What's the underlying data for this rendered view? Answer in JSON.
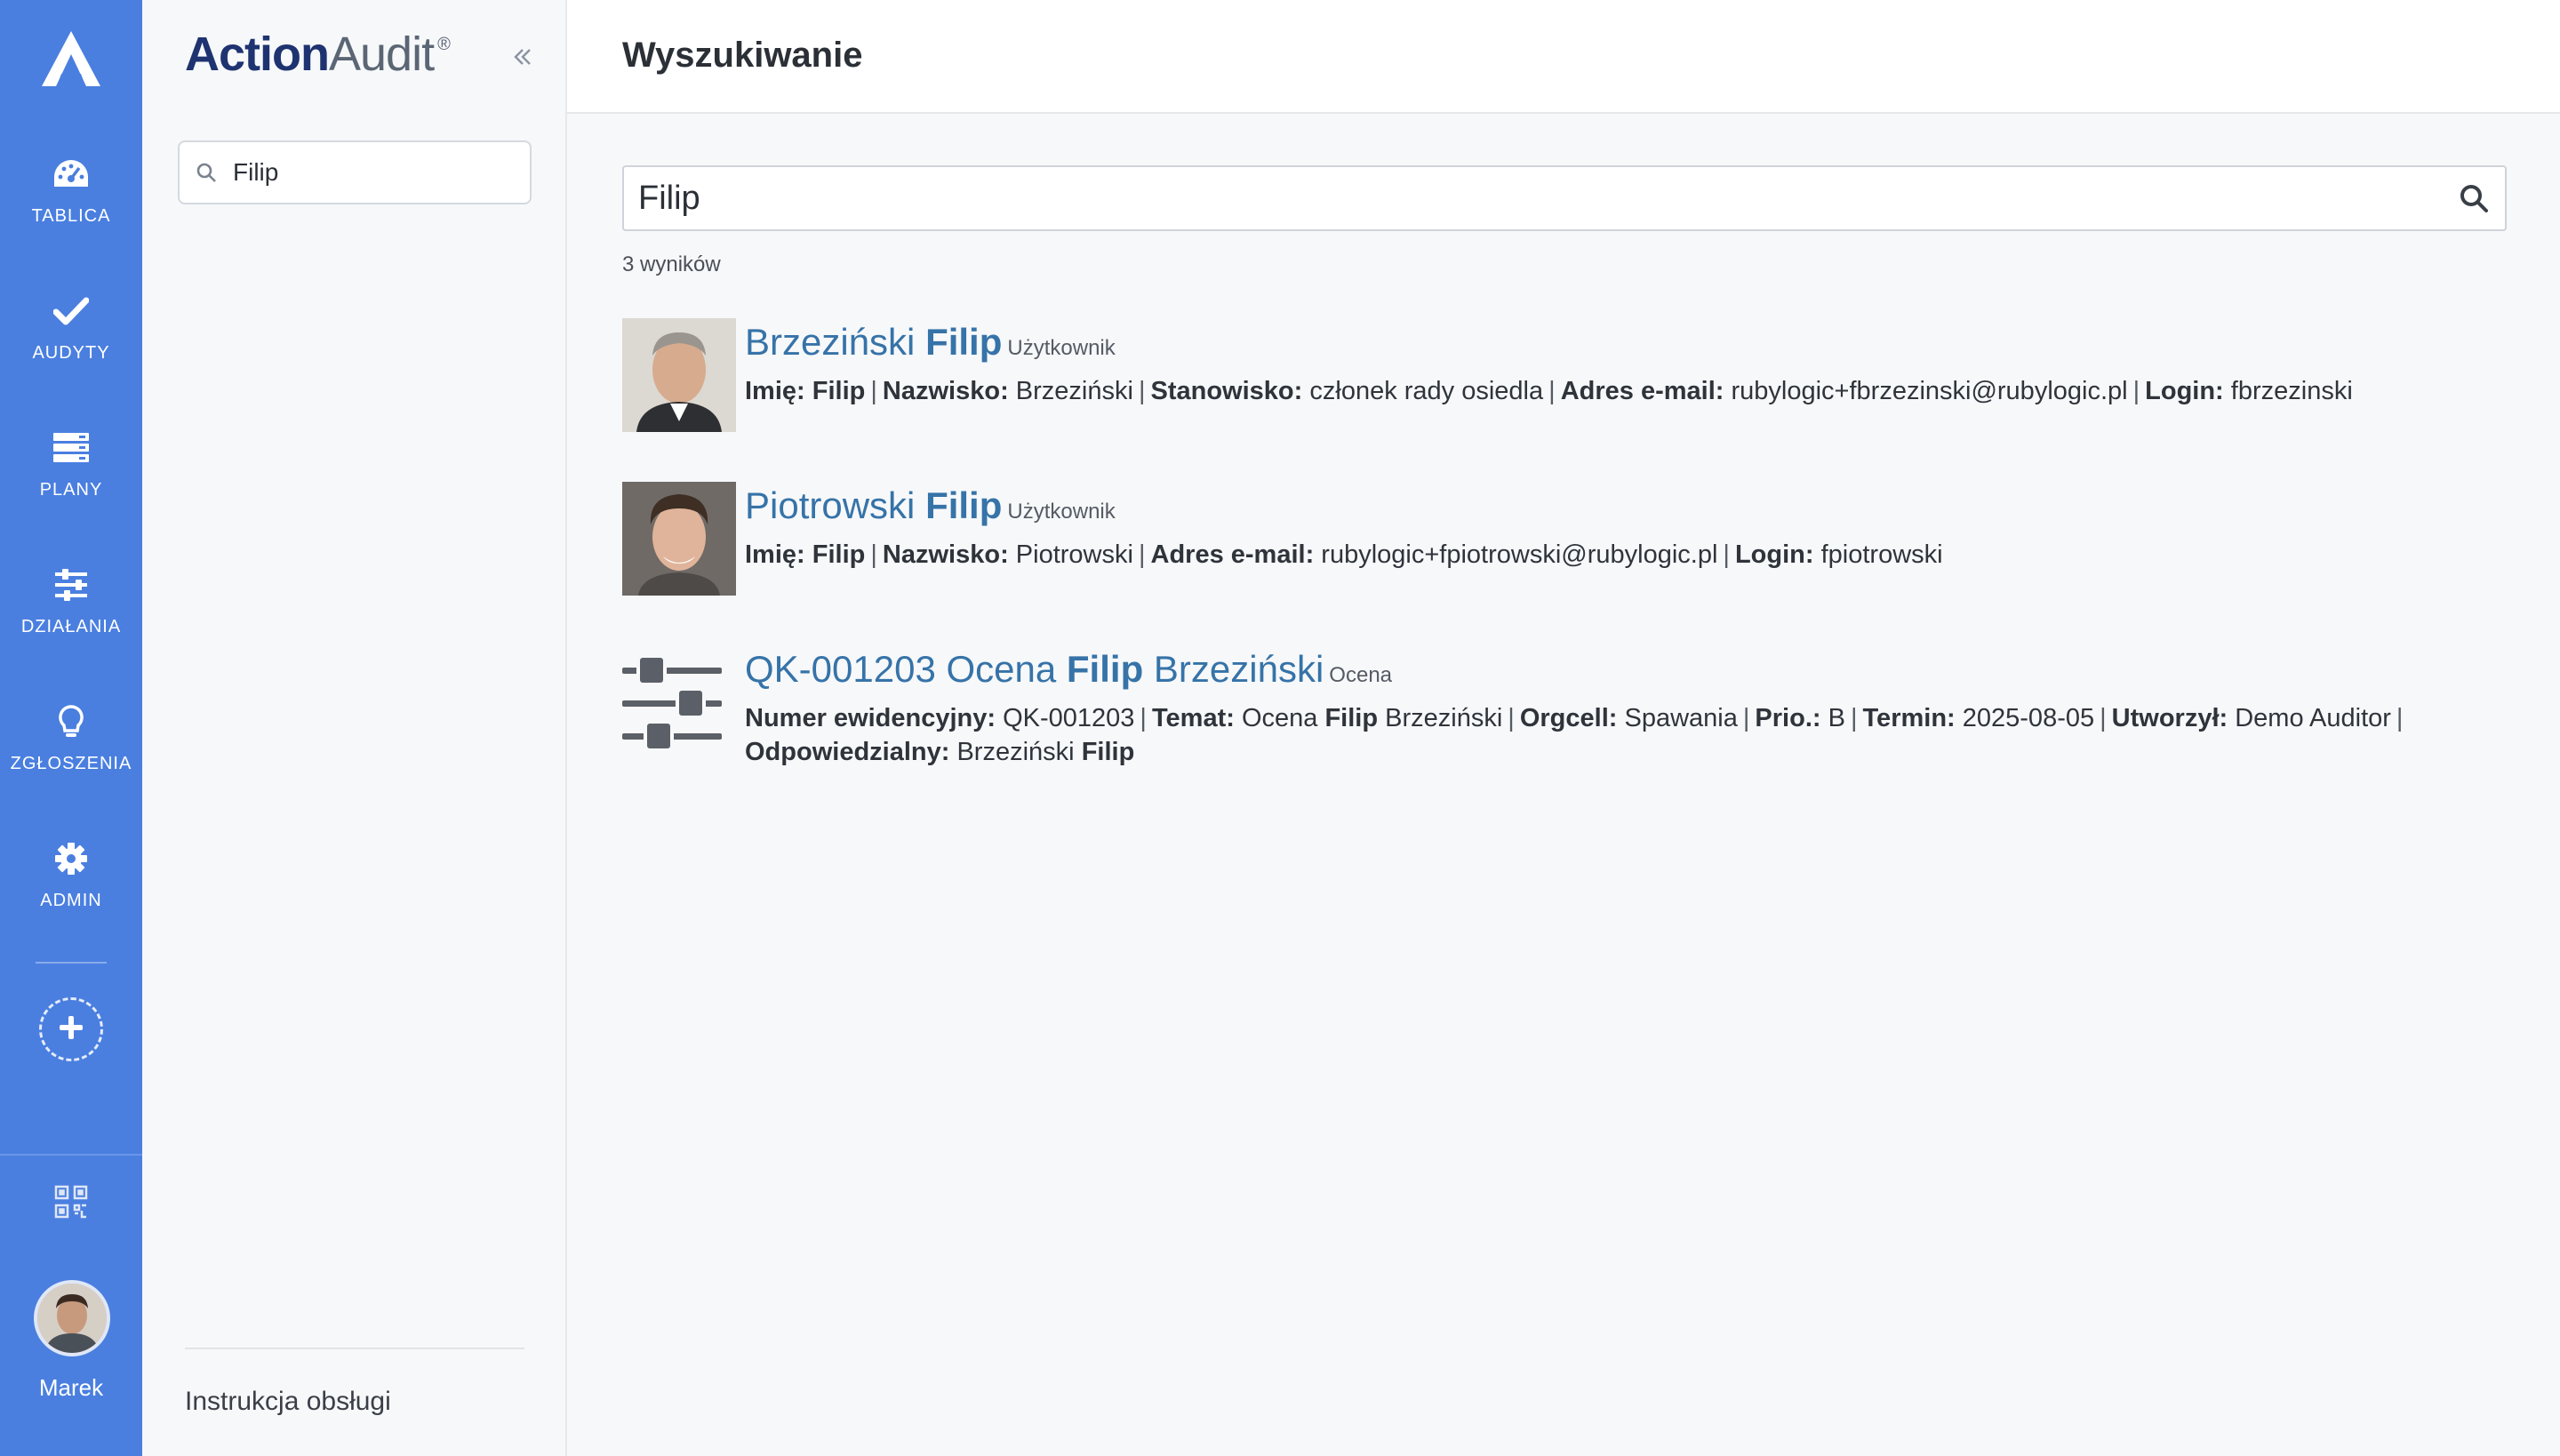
{
  "rail": {
    "items": [
      {
        "label": "TABLICA",
        "icon": "dashboard-icon"
      },
      {
        "label": "AUDYTY",
        "icon": "check-icon"
      },
      {
        "label": "PLANY",
        "icon": "plans-icon"
      },
      {
        "label": "DZIAŁANIA",
        "icon": "sliders-icon"
      },
      {
        "label": "ZGŁOSZENIA",
        "icon": "lightbulb-icon"
      },
      {
        "label": "ADMIN",
        "icon": "gear-icon"
      }
    ],
    "user": "Marek"
  },
  "sidebar": {
    "brand_main": "Action",
    "brand_second": "Audit",
    "brand_mark": "®",
    "search_value": "Filip",
    "footer_link": "Instrukcja obsługi"
  },
  "header": {
    "title": "Wyszukiwanie"
  },
  "search": {
    "value": "Filip",
    "count": "3 wyników"
  },
  "results": [
    {
      "title_pre": "Brzeziński ",
      "title_hl": "Filip",
      "title_post": "",
      "type": "Użytkownik",
      "meta": [
        {
          "key": "Imię:",
          "val": "",
          "hl": "Filip"
        },
        {
          "key": "Nazwisko:",
          "val": "Brzeziński",
          "hl": ""
        },
        {
          "key": "Stanowisko:",
          "val": "członek rady osiedla",
          "hl": ""
        },
        {
          "key": "Adres e-mail:",
          "val": "rubylogic+fbrzezinski@rubylogic.pl",
          "hl": ""
        },
        {
          "key": "Login:",
          "val": "fbrzezinski",
          "hl": ""
        }
      ]
    },
    {
      "title_pre": "Piotrowski ",
      "title_hl": "Filip",
      "title_post": "",
      "type": "Użytkownik",
      "meta": [
        {
          "key": "Imię:",
          "val": "",
          "hl": "Filip"
        },
        {
          "key": "Nazwisko:",
          "val": "Piotrowski",
          "hl": ""
        },
        {
          "key": "Adres e-mail:",
          "val": "rubylogic+fpiotrowski@rubylogic.pl",
          "hl": ""
        },
        {
          "key": "Login:",
          "val": "fpiotrowski",
          "hl": ""
        }
      ]
    },
    {
      "title_pre": "QK-001203 Ocena ",
      "title_hl": "Filip",
      "title_post": " Brzeziński",
      "type": "Ocena",
      "meta_line1": {
        "k1": "Numer ewidencyjny:",
        "v1": "QK-001203",
        "k2": "Temat:",
        "v2a": "Ocena",
        "v2hl": "Filip",
        "v2b": "Brzeziński",
        "k3": "Orgcell:",
        "v3": "Spawania",
        "k4": "Prio.:",
        "v4": "B",
        "k5": "Termin:",
        "v5": "2025-08-05",
        "k6": "Utworzył:",
        "v6": "Demo Auditor"
      },
      "meta_line2": {
        "k": "Odpowiedzialny:",
        "v": "Brzeziński",
        "hl": "Filip"
      }
    }
  ],
  "colors": {
    "rail": "#4a7fe0",
    "link": "#3673a8",
    "brand": "#1e3370"
  }
}
